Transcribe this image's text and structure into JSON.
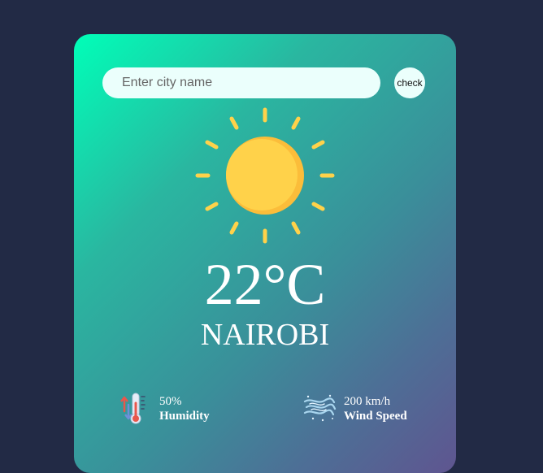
{
  "search": {
    "placeholder": "Enter city name",
    "button_label": "check"
  },
  "weather": {
    "icon": "sun-icon",
    "temperature": "22°C",
    "city": "NAIROBI"
  },
  "details": {
    "humidity": {
      "icon": "thermometer-icon",
      "value": "50%",
      "label": "Humidity"
    },
    "wind": {
      "icon": "wind-icon",
      "value": "200 km/h",
      "label": "Wind Speed"
    }
  },
  "colors": {
    "page_background": "#222a45",
    "card_gradient_start": "#00ffb8",
    "card_gradient_end": "#5f5590",
    "input_background": "#ebfffc",
    "sun": "#ffd24a"
  }
}
